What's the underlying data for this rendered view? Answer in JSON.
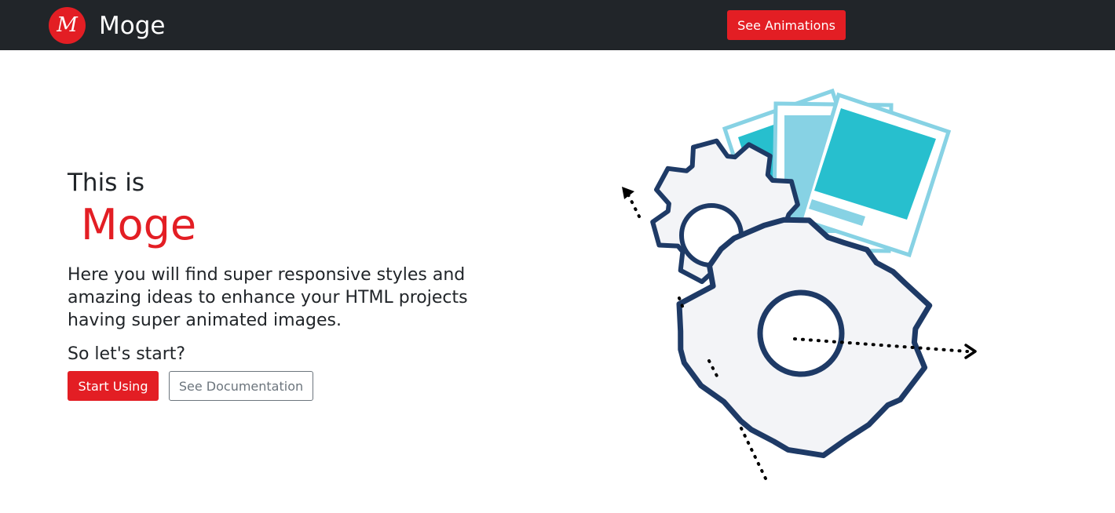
{
  "navbar": {
    "logo_letter": "M",
    "brand": "Moge",
    "animations_button": "See Animations"
  },
  "hero": {
    "pre_title": "This is",
    "title": "Moge",
    "description": "Here you will find super responsive styles and amazing ideas to enhance your HTML projects having super animated images.",
    "prompt": "So let's start?",
    "primary_button": "Start Using",
    "secondary_button": "See Documentation"
  },
  "colors": {
    "brand_red": "#e31e24",
    "navbar_bg": "#212529",
    "gear_stroke": "#1e3a66",
    "photo_teal": "#27bfce",
    "photo_light": "#87d2e4"
  },
  "illustration": {
    "icons": [
      "gear-icon",
      "photo-icon",
      "arrow-icon"
    ]
  }
}
